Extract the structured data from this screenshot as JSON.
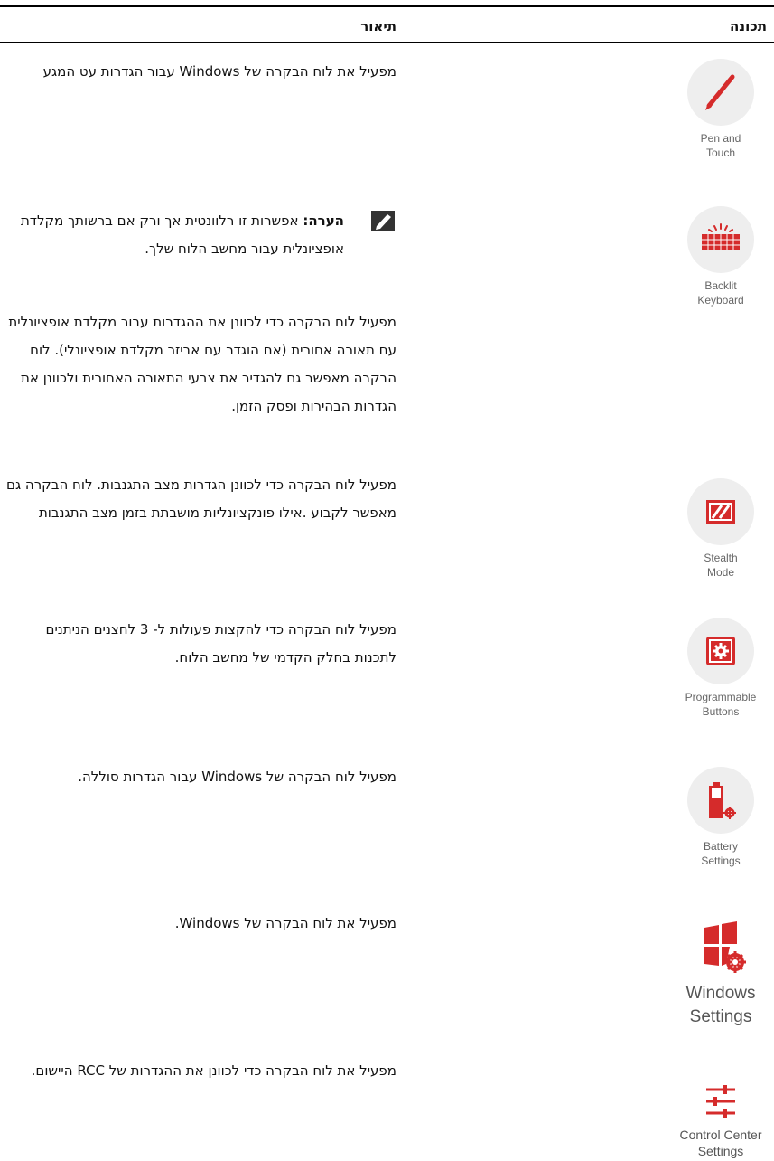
{
  "headers": {
    "feature": "תכונה",
    "description": "תיאור"
  },
  "colors": {
    "accent": "#d52b2b",
    "circle_bg": "#eeeeee"
  },
  "note": {
    "label": "הערה:",
    "text": "אפשרות זו רלוונטית אך ורק אם ברשותך מקלדת אופציונלית עבור מחשב הלוח שלך."
  },
  "rows": [
    {
      "icon": "pen-icon",
      "label": "Pen and\nTouch",
      "description": "מפעיל את לוח הבקרה של Windows עבור הגדרות עט המגע"
    },
    {
      "icon": "keyboard-icon",
      "label": "Backlit\nKeyboard",
      "description": "מפעיל לוח הבקרה כדי לכוונן את ההגדרות עבור מקלדת אופציונלית עם תאורה אחורית (אם הוגדר עם אביזר מקלדת אופציונלי). לוח הבקרה מאפשר גם להגדיר את צבעי התאורה האחורית ולכוונן את הגדרות הבהירות ופסק הזמן."
    },
    {
      "icon": "stealth-icon",
      "label": "Stealth\nMode",
      "description": "מפעיל לוח הבקרה כדי לכוונן הגדרות מצב התגנבות. לוח הבקרה גם מאפשר לקבוע .אילו פונקציונליות מושבתת בזמן מצב התגנבות"
    },
    {
      "icon": "gear-button-icon",
      "label": "Programmable\nButtons",
      "description": "מפעיל לוח הבקרה כדי להקצות פעולות ל- 3 לחצנים הניתנים לתכנות בחלק הקדמי של מחשב הלוח."
    },
    {
      "icon": "battery-icon",
      "label": "Battery\nSettings",
      "description": "מפעיל לוח הבקרה של Windows עבור הגדרות סוללה."
    },
    {
      "icon": "windows-gear-icon",
      "label": "Windows\nSettings",
      "description": "מפעיל את לוח הבקרה של Windows."
    },
    {
      "icon": "sliders-icon",
      "label": "Control Center\nSettings",
      "description": "מפעיל את לוח הבקרה כדי לכוונן את ההגדרות של RCC היישום."
    }
  ]
}
